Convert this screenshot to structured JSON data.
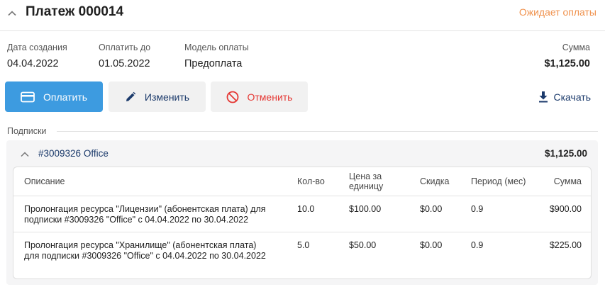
{
  "header": {
    "title": "Платеж 000014",
    "status": "Ожидает оплаты",
    "status_color": "#f0924e"
  },
  "info": {
    "created_label": "Дата создания",
    "created_value": "04.04.2022",
    "pay_until_label": "Оплатить до",
    "pay_until_value": "01.05.2022",
    "model_label": "Модель оплаты",
    "model_value": "Предоплата",
    "sum_label": "Сумма",
    "sum_value": "$1,125.00"
  },
  "actions": {
    "pay_label": "Оплатить",
    "pay_icon": "credit-card-icon",
    "edit_label": "Изменить",
    "edit_icon": "pencil-icon",
    "cancel_label": "Отменить",
    "cancel_icon": "cancel-circle-icon",
    "download_label": "Скачать",
    "download_icon": "download-icon",
    "accent": "#3d9be0"
  },
  "subscriptions": {
    "section_label": "Подписки",
    "items": [
      {
        "title": "#3009326 Office",
        "total": "$1,125.00",
        "columns": [
          "Описание",
          "Кол-во",
          "Цена за единицу",
          "Скидка",
          "Период (мес)",
          "Сумма"
        ],
        "rows": [
          {
            "description": "Пролонгация ресурса \"Лицензии\" (абонентская плата) для подписки #3009326 \"Office\" с 04.04.2022 по 30.04.2022",
            "qty": "10.0",
            "price": "$100.00",
            "discount": "$0.00",
            "period": "0.9",
            "sum": "$900.00"
          },
          {
            "description": "Пролонгация ресурса \"Хранилище\" (абонентская плата) для подписки #3009326 \"Office\" с 04.04.2022 по 30.04.2022",
            "qty": "5.0",
            "price": "$50.00",
            "discount": "$0.00",
            "period": "0.9",
            "sum": "$225.00"
          }
        ]
      }
    ]
  }
}
